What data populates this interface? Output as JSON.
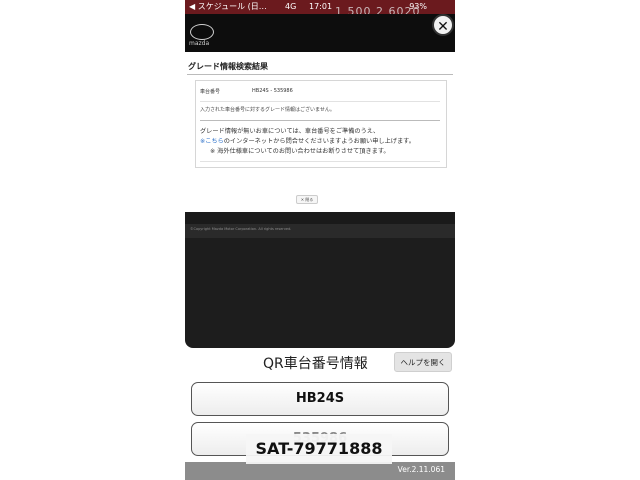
{
  "status_bar": {
    "back_label": "◀ スケジュール (日…",
    "network": "4G",
    "time": "17:01",
    "battery": "93%"
  },
  "ghost_text": "1 500 2 6020",
  "modal": {
    "brand": "mazda",
    "close_glyph": "✕",
    "title": "グレード情報検索結果",
    "vehicle_number_label": "車台番号",
    "vehicle_number_value": "HB24S - 535986",
    "not_found_message": "入力された車台番号に対するグレード情報はございません。",
    "help_line1": "グレード情報が無いお車については、車台番号をご準備のうえ、",
    "help_line2_mark": "※",
    "help_line2_link": "こちら",
    "help_line2_rest": "のインターネットから問合せくださいますようお願い申し上げます。",
    "help_line3": "※ 海外仕様車についてのお問い合わせはお断りさせて頂きます。",
    "close_button": "✕ 閉る",
    "copyright": "©Copyright Mazda Motor Corporation. All rights reserved."
  },
  "qr_section": {
    "title": "QR車台番号情報",
    "help_button": "ヘルプを開く"
  },
  "fields": {
    "model": "HB24S",
    "serial": "535986"
  },
  "footer": {
    "version": "Ver.2.11.061"
  },
  "overlay_watermark": "SAT-79771888",
  "colors": {
    "status_bar": "#6b1a1e",
    "link": "#2a6fc9",
    "footer": "#8c8c8c"
  }
}
